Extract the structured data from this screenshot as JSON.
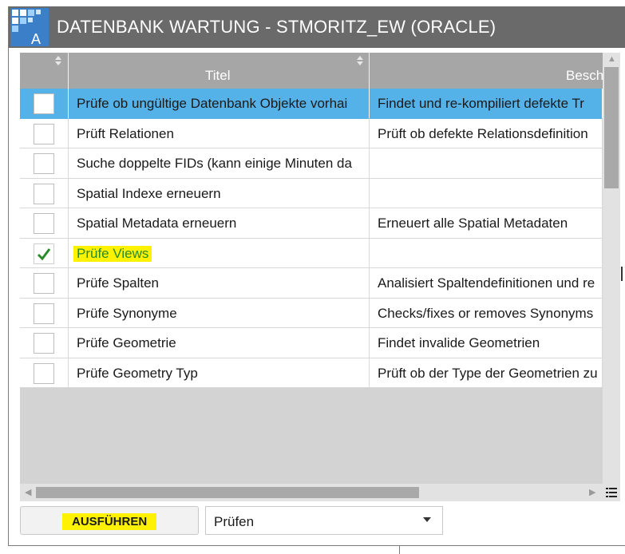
{
  "window": {
    "title": "DATENBANK WARTUNG - STMORITZ_EW (ORACLE)"
  },
  "grid": {
    "columns": [
      "",
      "Titel",
      "Besch"
    ],
    "rows": [
      {
        "checked": false,
        "selected": true,
        "title": "Prüfe ob ungültige Datenbank Objekte vorhai",
        "description": "Findet und re-kompiliert defekte  Tr"
      },
      {
        "checked": false,
        "selected": false,
        "title": "Prüft Relationen",
        "description": "Prüft ob defekte Relationsdefinition"
      },
      {
        "checked": false,
        "selected": false,
        "title": "Suche doppelte FIDs (kann einige Minuten da",
        "description": ""
      },
      {
        "checked": false,
        "selected": false,
        "title": "Spatial Indexe erneuern",
        "description": ""
      },
      {
        "checked": false,
        "selected": false,
        "title": "Spatial Metadata erneuern",
        "description": "Erneuert alle Spatial Metadaten"
      },
      {
        "checked": true,
        "selected": false,
        "title": "Prüfe Views",
        "description": ""
      },
      {
        "checked": false,
        "selected": false,
        "title": "Prüfe Spalten",
        "description": "Analisiert Spaltendefinitionen und re"
      },
      {
        "checked": false,
        "selected": false,
        "title": "Prüfe Synonyme",
        "description": "Checks/fixes or removes Synonyms"
      },
      {
        "checked": false,
        "selected": false,
        "title": "Prüfe Geometrie",
        "description": "Findet invalide Geometrien"
      },
      {
        "checked": false,
        "selected": false,
        "title": "Prüfe Geometry Typ",
        "description": "Prüft ob der Type der Geometrien zu"
      }
    ]
  },
  "footer": {
    "run_label": "AUSFÜHREN",
    "mode_value": "Prüfen"
  },
  "colors": {
    "titlebar": "#6a6a6a",
    "header": "#a6a6a6",
    "selection": "#55b2e8",
    "highlight": "#fff200",
    "check": "#2a8a2a"
  },
  "icons": [
    "app-icon",
    "sort-icon",
    "checkmark-icon",
    "scroll-left-icon",
    "scroll-right-icon",
    "column-chooser-icon",
    "dropdown-caret-icon"
  ]
}
